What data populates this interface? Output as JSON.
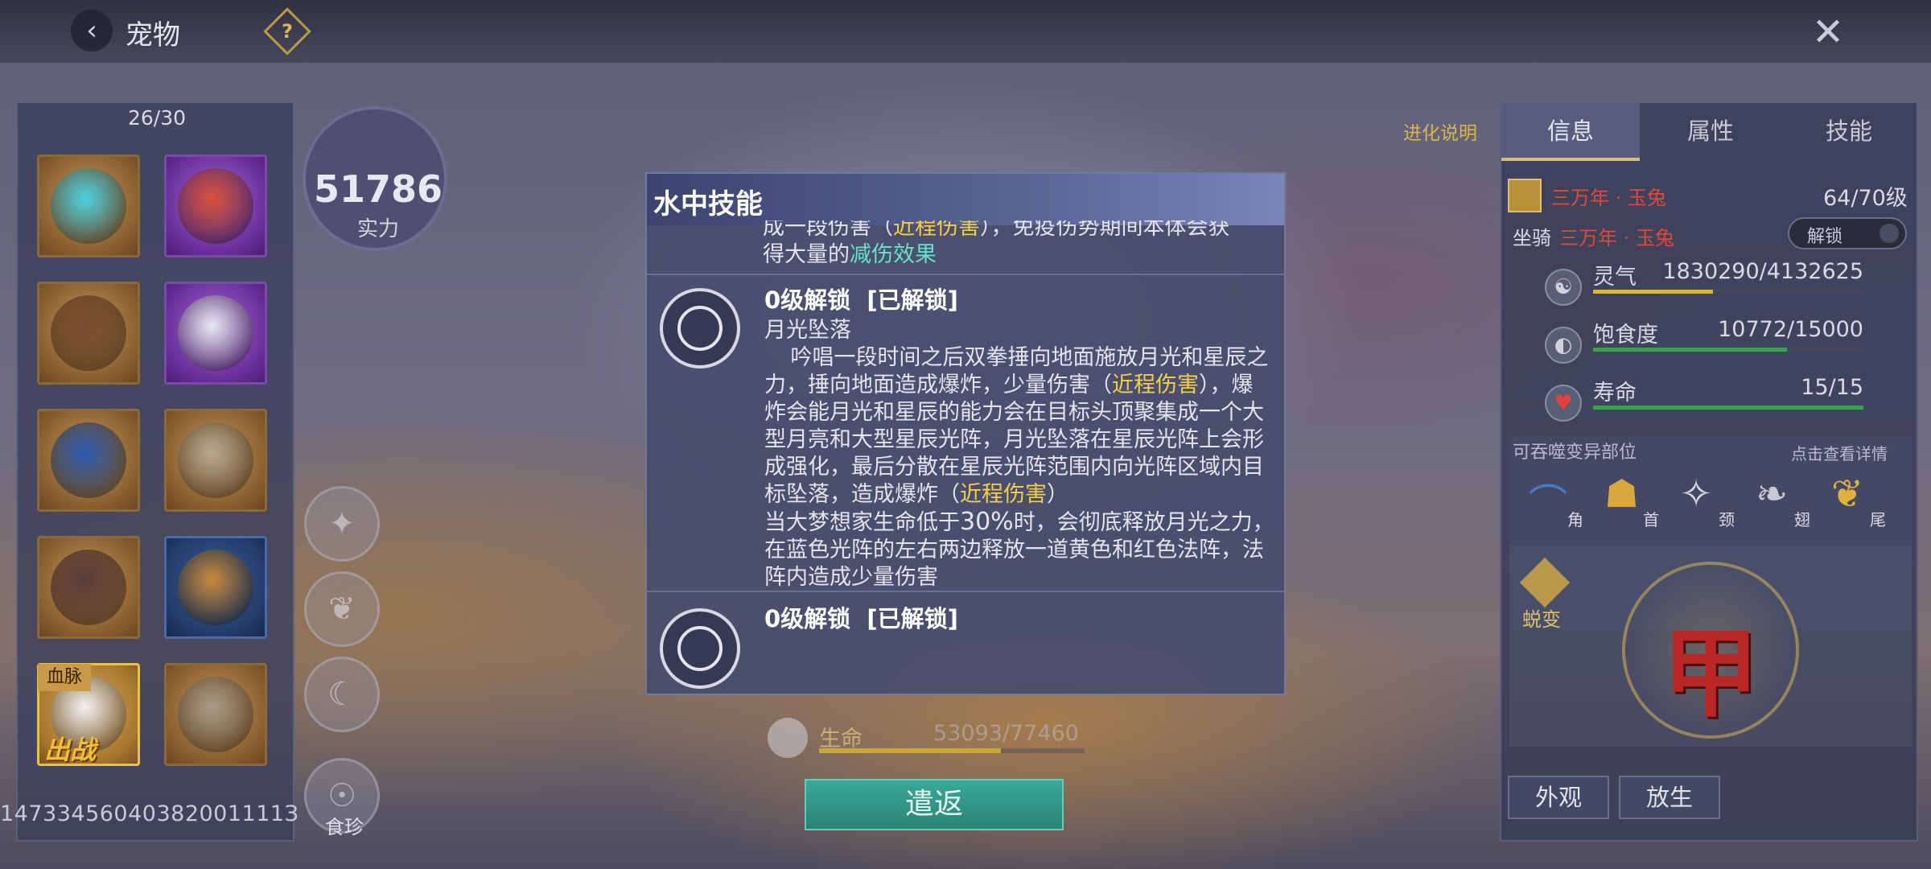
{
  "topbar": {
    "title": "宠物",
    "back_icon": "back-arrow-icon",
    "help_icon": "help-icon",
    "close_icon": "close-icon"
  },
  "pet_list": {
    "count": "26/30",
    "pets": [
      {
        "frame": "orange",
        "name": "blue-flame-beast"
      },
      {
        "frame": "purple",
        "name": "red-crested-dragon"
      },
      {
        "frame": "orange",
        "name": "horned-child"
      },
      {
        "frame": "purple",
        "name": "white-haired-girl"
      },
      {
        "frame": "orange",
        "name": "blue-bird"
      },
      {
        "frame": "orange",
        "name": "skull-beast"
      },
      {
        "frame": "orange",
        "name": "spiked-boar"
      },
      {
        "frame": "blue",
        "name": "golden-lion"
      },
      {
        "frame": "gold",
        "name": "jade-rabbit",
        "blood_tag": "血脉",
        "battle_tag": "出战"
      },
      {
        "frame": "orange",
        "name": "bone-dragon"
      }
    ],
    "player_id": "14733456040382001111З"
  },
  "power": {
    "value": "51786",
    "label": "实力"
  },
  "side_icons": [
    "phoenix-icon",
    "bird-icon",
    "crescent-icon"
  ],
  "food": {
    "label": "食珍"
  },
  "evolve_link": "进化说明",
  "dialog": {
    "title": "水中技能",
    "partial_top": {
      "line1_prefix": "成一段伤害（",
      "line1_hl": "近程伤害",
      "line1_suffix": "），免疫伤势期间本体会获",
      "line2_prefix": "得大量的",
      "line2_hl": "减伤效果"
    },
    "skills": [
      {
        "unlock": "0级解锁",
        "status": "[已解锁]",
        "name": "月光坠落",
        "desc1": "吟唱一段时间之后双拳捶向地面施放月光和星辰之力，捶向地面造成爆炸，少量伤害（",
        "desc1_hl": "近程伤害",
        "desc2": "），爆炸会能月光和星辰的能力会在目标头顶聚集成一个大型月亮和大型星辰光阵，月光坠落在星辰光阵上会形成强化，最后分散在星辰光阵范围内向光阵区域内目标坠落，造成爆炸（",
        "desc2_hl": "近程伤害",
        "desc3": "）",
        "desc4_prefix": "当大梦想家生命低于",
        "desc4_num": "30%",
        "desc4_suffix": "时，会彻底释放月光之力，在蓝色光阵的左右两边释放一道黄色和红色法阵，法阵内造成少量伤害"
      },
      {
        "unlock": "0级解锁",
        "status": "[已解锁]"
      }
    ]
  },
  "hp": {
    "label": "生命",
    "value": "53093/77460",
    "ratio": 0.6854
  },
  "return_button": "遣返",
  "info": {
    "tabs": [
      "信息",
      "属性",
      "技能"
    ],
    "active_tab": 0,
    "pet_name": "三万年 · 玉兔",
    "level": "64/70级",
    "mount_label": "坐骑",
    "mount_name": "三万年 · 玉兔",
    "unlock_toggle": "解锁",
    "stats": [
      {
        "label": "灵气",
        "value": "1830290/4132625",
        "ratio": 0.4429,
        "color": "#d8b83a",
        "icon": "spirit-icon"
      },
      {
        "label": "饱食度",
        "value": "10772/15000",
        "ratio": 0.7181,
        "color": "#3aa04a",
        "icon": "stomach-icon"
      },
      {
        "label": "寿命",
        "value": "15/15",
        "ratio": 1.0,
        "color": "#3aa04a",
        "icon": "heart-icon"
      }
    ],
    "parts_title": "可吞噬变异部位",
    "parts_link": "点击查看详情",
    "parts": [
      {
        "label": "角",
        "icon": "horn-icon",
        "color": "#4a7ac8"
      },
      {
        "label": "首",
        "icon": "head-icon",
        "color": "#d8a83a"
      },
      {
        "label": "颈",
        "icon": "neck-icon",
        "color": "#d8d8e0"
      },
      {
        "label": "翅",
        "icon": "wing-icon",
        "color": "#c8c8d0"
      },
      {
        "label": "尾",
        "icon": "tail-icon",
        "color": "#e0b040"
      }
    ],
    "mutate_label": "蜕变",
    "seal_glyph": "甲",
    "appearance_button": "外观",
    "release_button": "放生"
  }
}
